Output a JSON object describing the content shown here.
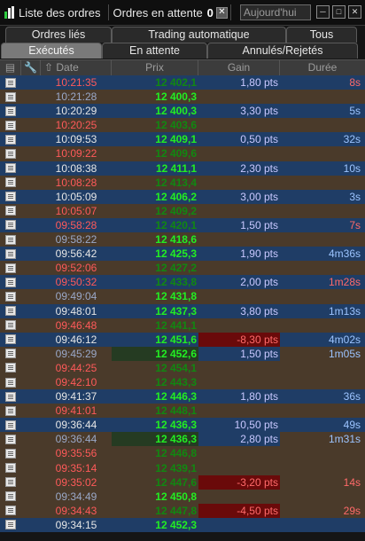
{
  "titlebar": {
    "title": "Liste des ordres",
    "pending_label": "Ordres en attente",
    "pending_count": "0",
    "date_placeholder": "Aujourd'hui"
  },
  "tabs_row1": [
    "Ordres liés",
    "Trading automatique",
    "Tous"
  ],
  "tabs_row2": [
    "Exécutés",
    "En attente",
    "Annulés/Rejetés"
  ],
  "active_tab": "Exécutés",
  "columns": {
    "date": "Date",
    "price": "Prix",
    "gain": "Gain",
    "duration": "Durée"
  },
  "rows": [
    {
      "date": "10:21:35",
      "price": "12 402,1",
      "gain": "1,80 pts",
      "dur": "8s",
      "side": "sell",
      "bg": "blue"
    },
    {
      "date": "10:21:28",
      "price": "12 400,3",
      "gain": "",
      "dur": "",
      "side": "buy",
      "bg": "brown"
    },
    {
      "date": "10:20:29",
      "price": "12 400,3",
      "gain": "3,30 pts",
      "dur": "5s",
      "side": "buy",
      "bg": "blue"
    },
    {
      "date": "10:20:25",
      "price": "12 403,6",
      "gain": "",
      "dur": "",
      "side": "sell",
      "bg": "brown"
    },
    {
      "date": "10:09:53",
      "price": "12 409,1",
      "gain": "0,50 pts",
      "dur": "32s",
      "side": "buy",
      "bg": "blue"
    },
    {
      "date": "10:09:22",
      "price": "12 409,6",
      "gain": "",
      "dur": "",
      "side": "sell",
      "bg": "brown"
    },
    {
      "date": "10:08:38",
      "price": "12 411,1",
      "gain": "2,30 pts",
      "dur": "10s",
      "side": "buy",
      "bg": "blue"
    },
    {
      "date": "10:08:28",
      "price": "12 413,4",
      "gain": "",
      "dur": "",
      "side": "sell",
      "bg": "brown"
    },
    {
      "date": "10:05:09",
      "price": "12 406,2",
      "gain": "3,00 pts",
      "dur": "3s",
      "side": "buy",
      "bg": "blue"
    },
    {
      "date": "10:05:07",
      "price": "12 409,2",
      "gain": "",
      "dur": "",
      "side": "sell",
      "bg": "brown"
    },
    {
      "date": "09:58:28",
      "price": "12 420,1",
      "gain": "1,50 pts",
      "dur": "7s",
      "side": "sell",
      "bg": "blue"
    },
    {
      "date": "09:58:22",
      "price": "12 418,6",
      "gain": "",
      "dur": "",
      "side": "buy",
      "bg": "brown"
    },
    {
      "date": "09:56:42",
      "price": "12 425,3",
      "gain": "1,90 pts",
      "dur": "4m36s",
      "side": "buy",
      "bg": "blue"
    },
    {
      "date": "09:52:06",
      "price": "12 427,2",
      "gain": "",
      "dur": "",
      "side": "sell",
      "bg": "brown"
    },
    {
      "date": "09:50:32",
      "price": "12 433,8",
      "gain": "2,00 pts",
      "dur": "1m28s",
      "side": "sell",
      "bg": "blue"
    },
    {
      "date": "09:49:04",
      "price": "12 431,8",
      "gain": "",
      "dur": "",
      "side": "buy",
      "bg": "brown"
    },
    {
      "date": "09:48:01",
      "price": "12 437,3",
      "gain": "3,80 pts",
      "dur": "1m13s",
      "side": "buy",
      "bg": "blue"
    },
    {
      "date": "09:46:48",
      "price": "12 441,1",
      "gain": "",
      "dur": "",
      "side": "sell",
      "bg": "brown"
    },
    {
      "date": "09:46:12",
      "price": "12 451,6",
      "gain": "-8,30 pts",
      "dur": "4m02s",
      "side": "buy",
      "bg": "blue",
      "neg": true
    },
    {
      "date": "09:45:29",
      "price": "12 452,6",
      "gain": "1,50 pts",
      "dur": "1m05s",
      "side": "buy",
      "bg": "brown",
      "pos": true
    },
    {
      "date": "09:44:25",
      "price": "12 454,1",
      "gain": "",
      "dur": "",
      "side": "sell",
      "bg": "brown"
    },
    {
      "date": "09:42:10",
      "price": "12 443,3",
      "gain": "",
      "dur": "",
      "side": "sell",
      "bg": "brown"
    },
    {
      "date": "09:41:37",
      "price": "12 446,3",
      "gain": "1,80 pts",
      "dur": "36s",
      "side": "buy",
      "bg": "blue"
    },
    {
      "date": "09:41:01",
      "price": "12 448,1",
      "gain": "",
      "dur": "",
      "side": "sell",
      "bg": "brown"
    },
    {
      "date": "09:36:44",
      "price": "12 436,3",
      "gain": "10,50 pts",
      "dur": "49s",
      "side": "buy",
      "bg": "blue"
    },
    {
      "date": "09:36:44",
      "price": "12 436,3",
      "gain": "2,80 pts",
      "dur": "1m31s",
      "side": "buy",
      "bg": "brown",
      "pos": true
    },
    {
      "date": "09:35:56",
      "price": "12 446,8",
      "gain": "",
      "dur": "",
      "side": "sell",
      "bg": "brown"
    },
    {
      "date": "09:35:14",
      "price": "12 439,1",
      "gain": "",
      "dur": "",
      "side": "sell",
      "bg": "brown"
    },
    {
      "date": "09:35:02",
      "price": "12 447,6",
      "gain": "-3,20 pts",
      "dur": "14s",
      "side": "sell",
      "bg": "brown",
      "neg": true
    },
    {
      "date": "09:34:49",
      "price": "12 450,8",
      "gain": "",
      "dur": "",
      "side": "buy",
      "bg": "brown"
    },
    {
      "date": "09:34:43",
      "price": "12 447,8",
      "gain": "-4,50 pts",
      "dur": "29s",
      "side": "sell",
      "bg": "brown",
      "neg": true
    },
    {
      "date": "09:34:15",
      "price": "12 452,3",
      "gain": "",
      "dur": "",
      "side": "buy",
      "bg": "blue"
    }
  ]
}
